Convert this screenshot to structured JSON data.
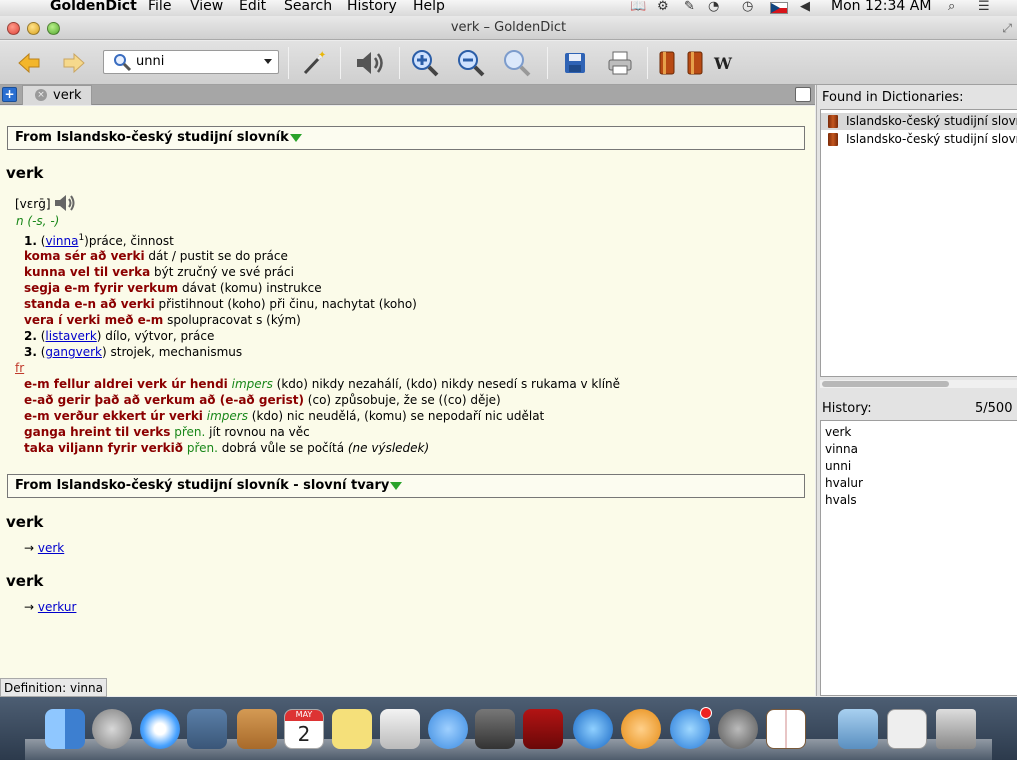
{
  "menubar": {
    "app": "GoldenDict",
    "items": [
      "File",
      "View",
      "Edit",
      "Search",
      "History",
      "Help"
    ],
    "clock": "Mon 12:34 AM"
  },
  "window": {
    "title": "verk – GoldenDict"
  },
  "toolbar": {
    "search_value": "unni",
    "wiki_label": "W"
  },
  "tabs": [
    {
      "label": "verk"
    }
  ],
  "article": {
    "dict1": "From Islandsko-český studijní slovník",
    "headword1": "verk",
    "pron": "[vɛrḡ]",
    "grammar": "n (-s, -)",
    "sense1_num": "1.",
    "sense1_open": "(",
    "sense1_link": "vinna",
    "sense1_sup": "1",
    "sense1_rest": ")práce, činnost",
    "phrases1": [
      {
        "is": "koma sér að verki",
        "cs": " dát / pustit se do práce"
      },
      {
        "is": "kunna vel til verka",
        "cs": " být zručný ve své práci"
      },
      {
        "is": "segja e-m fyrir verkum",
        "cs": " dávat (komu) instrukce"
      },
      {
        "is": "standa e-n að verki",
        "cs": " přistihnout (koho) při činu, nachytat (koho)"
      },
      {
        "is": "vera í verki með e-m",
        "cs": " spolupracovat s (kým)"
      }
    ],
    "sense2_num": "2.",
    "sense2_link": "listaverk",
    "sense2_rest": ") dílo, výtvor, práce",
    "sense3_num": "3.",
    "sense3_link": "gangverk",
    "sense3_rest": ") strojek, mechanismus",
    "fr": "fr",
    "phrases2": [
      {
        "is": "e-m fellur aldrei verk úr hendi",
        "note": "impers",
        "cs": " (kdo) nikdy nezahálí, (kdo) nikdy nesedí s rukama v klíně"
      },
      {
        "is": "e-að gerir það að verkum að (e-að gerist)",
        "note": "",
        "cs": " (co) způsobuje, že se ((co) děje)"
      },
      {
        "is": "e-m verður ekkert úr verki",
        "note": "impers",
        "cs": " (kdo) nic neudělá, (komu) se nepodaří nic udělat"
      },
      {
        "is": "ganga hreint til verks",
        "label": "přen.",
        "cs": " jít rovnou na věc"
      },
      {
        "is": "taka viljann fyrir verkið",
        "label": "přen.",
        "cs": " dobrá vůle se počítá ",
        "cs_it": "(ne výsledek)"
      }
    ],
    "dict2": "From Islandsko-český studijní slovník - slovní tvary",
    "forms": [
      {
        "headword": "verk",
        "arrow": "→",
        "link": "verk"
      },
      {
        "headword": "verk",
        "arrow": "→",
        "link": "verkur"
      }
    ]
  },
  "found": {
    "title": "Found in Dictionaries:",
    "items": [
      "Islandsko-český studijní slovník",
      "Islandsko-český studijní slovník - slovní tvary"
    ]
  },
  "history": {
    "title": "History:",
    "count": "5/500",
    "items": [
      "verk",
      "vinna",
      "unni",
      "hvalur",
      "hvals"
    ]
  },
  "status": "Definition: vinna",
  "calendar": {
    "month": "MAY",
    "day": "2"
  }
}
